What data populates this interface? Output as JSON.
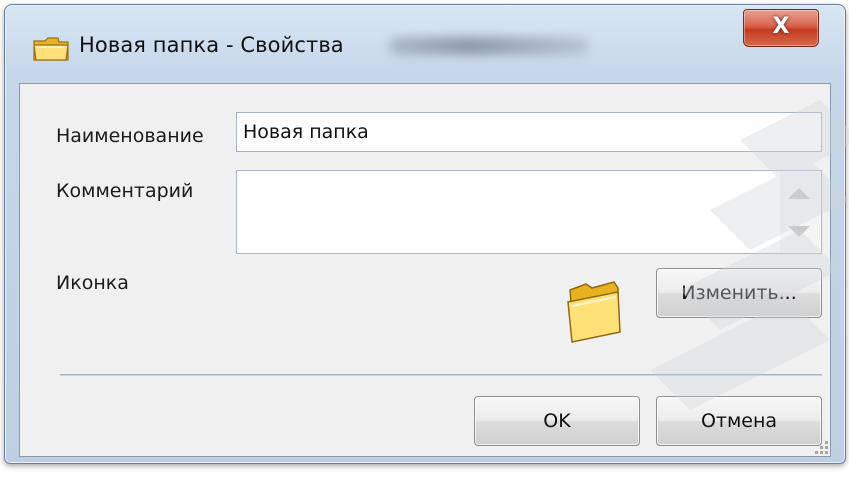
{
  "window": {
    "title": "Новая папка - Свойства",
    "title_icon": "folder-icon",
    "close_label": "X",
    "close_icon": "close-icon"
  },
  "form": {
    "name_label": "Наименование",
    "name_value": "Новая папка",
    "comment_label": "Комментарий",
    "comment_value": "",
    "icon_label": "Иконка",
    "icon_preview": "folder-icon",
    "change_button": "Изменить..."
  },
  "footer": {
    "ok_label": "OK",
    "cancel_label": "Отмена"
  },
  "colors": {
    "close_button": "#c53b21",
    "folder_yellow": "#f2c12e",
    "window_frame": "#c6d7ea",
    "client_bg": "#f0f0f0"
  }
}
